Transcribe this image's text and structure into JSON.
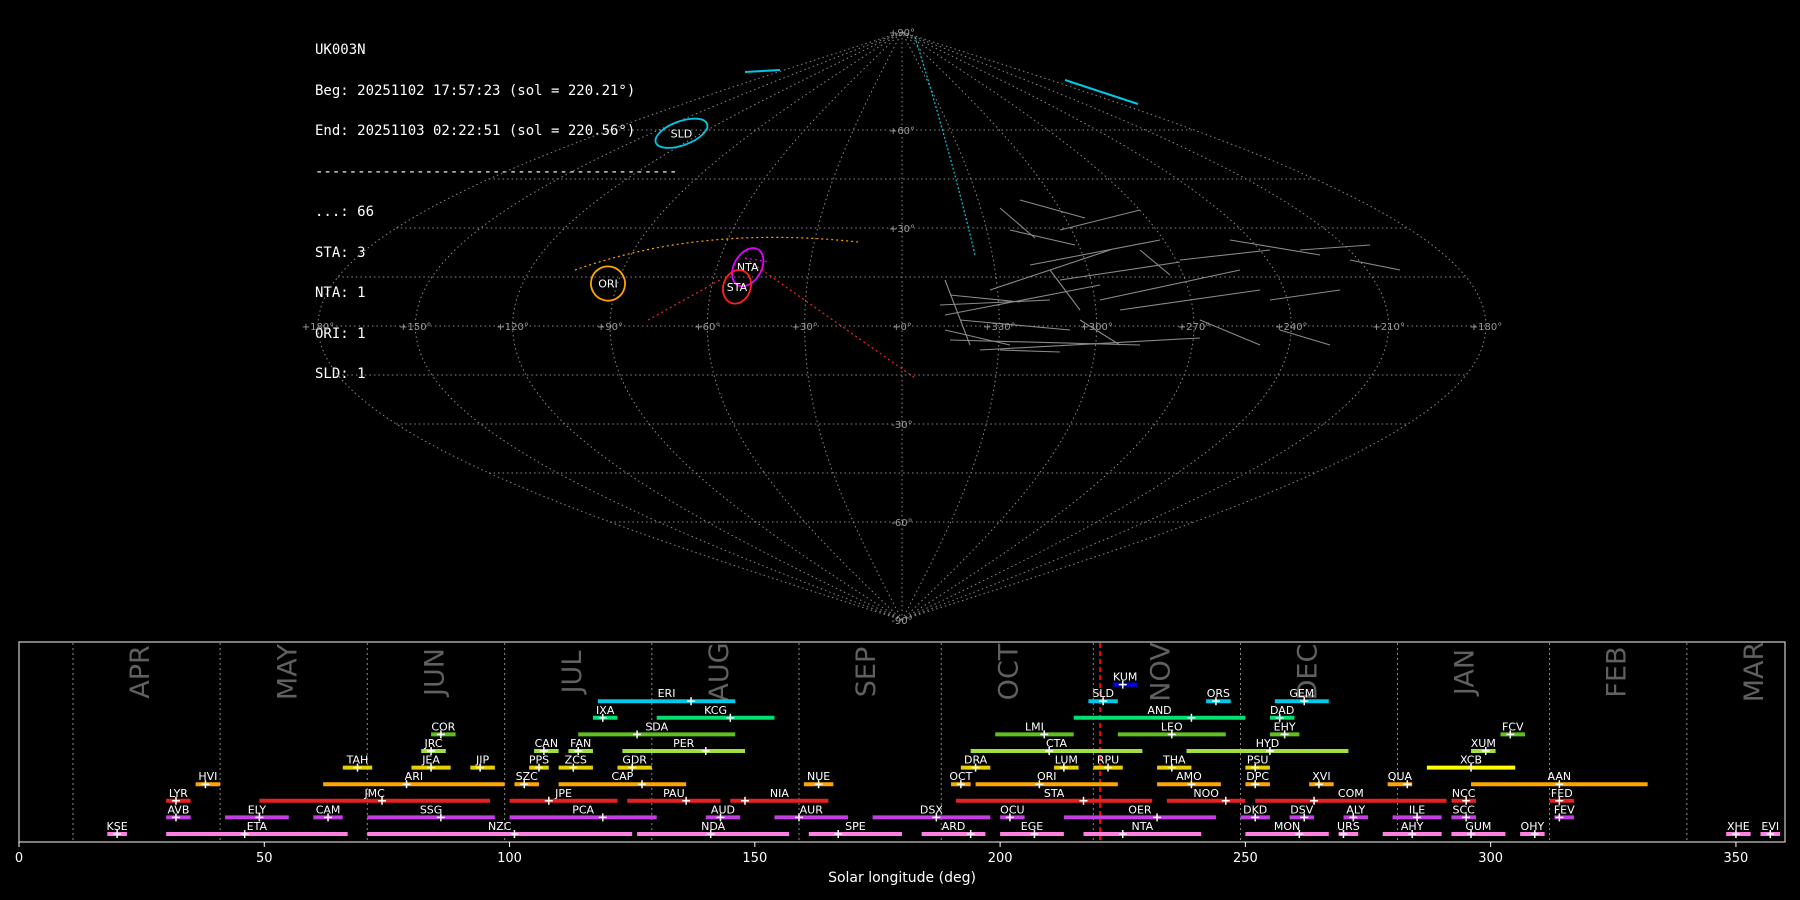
{
  "info": {
    "station": "UK003N",
    "begin": "Beg: 20251102 17:57:23 (sol = 220.21°)",
    "end": "End: 20251103 02:22:51 (sol = 220.56°)",
    "separator": "-------------------------------------------",
    "counts": [
      "...: 66",
      "STA: 3",
      "NTA: 1",
      "ORI: 1",
      "SLD: 1"
    ]
  },
  "sky_map": {
    "lon_labels": [
      "+180°",
      "+150°",
      "+120°",
      "+90°",
      "+60°",
      "+30°",
      "+0°",
      "+330°",
      "+300°",
      "+270°",
      "+240°",
      "+210°",
      "+180°"
    ],
    "lat_labels": [
      "+90°",
      "+60°",
      "+30°",
      "-30°",
      "-60°",
      "-90°"
    ],
    "radiants": [
      {
        "code": "SLD",
        "color": "#00c8e6",
        "lon": 132,
        "lat": 59,
        "rx": 8,
        "ry": 3.5,
        "rot": -20
      },
      {
        "code": "ORI",
        "color": "#ffa500",
        "lon": 93,
        "lat": 13,
        "rx": 5,
        "ry": 5,
        "rot": -30
      },
      {
        "code": "NTA",
        "color": "#e000ff",
        "lon": 50,
        "lat": 18,
        "rx": 4,
        "ry": 6,
        "rot": 30
      },
      {
        "code": "STA",
        "color": "#ff2020",
        "lon": 52,
        "lat": 12,
        "rx": 4,
        "ry": 5,
        "rot": 20
      }
    ]
  },
  "chart_data": {
    "type": "timeline",
    "xlabel": "Solar longitude (deg)",
    "xlim": [
      0,
      360
    ],
    "xticks": [
      0,
      50,
      100,
      150,
      200,
      250,
      300,
      350
    ],
    "current_sol": 220.4,
    "months": [
      {
        "name": "APR",
        "start": 11
      },
      {
        "name": "MAY",
        "start": 41
      },
      {
        "name": "JUN",
        "start": 71
      },
      {
        "name": "JUL",
        "start": 99
      },
      {
        "name": "AUG",
        "start": 129
      },
      {
        "name": "SEP",
        "start": 159
      },
      {
        "name": "OCT",
        "start": 188
      },
      {
        "name": "NOV",
        "start": 219
      },
      {
        "name": "DEC",
        "start": 249
      },
      {
        "name": "JAN",
        "start": 281
      },
      {
        "name": "FEB",
        "start": 312
      },
      {
        "name": "MAR",
        "start": 340
      }
    ],
    "showers": [
      {
        "code": "KUM",
        "row": 9,
        "start": 223,
        "end": 228,
        "peak": 225,
        "color": "#0000ff"
      },
      {
        "code": "ERI",
        "row": 8,
        "start": 118,
        "end": 146,
        "peak": 137,
        "color": "#00c8e6"
      },
      {
        "code": "SLD",
        "row": 8,
        "start": 218,
        "end": 224,
        "peak": 221,
        "color": "#00c8e6"
      },
      {
        "code": "ORS",
        "row": 8,
        "start": 242,
        "end": 247,
        "peak": 244,
        "color": "#00c8e6"
      },
      {
        "code": "GEM",
        "row": 8,
        "start": 256,
        "end": 267,
        "peak": 262,
        "color": "#00c8e6"
      },
      {
        "code": "IXA",
        "row": 7,
        "start": 117,
        "end": 122,
        "peak": 119,
        "color": "#00e070"
      },
      {
        "code": "KCG",
        "row": 7,
        "start": 130,
        "end": 154,
        "peak": 145,
        "color": "#00e070"
      },
      {
        "code": "AND",
        "row": 7,
        "start": 215,
        "end": 250,
        "peak": 239,
        "color": "#00e070"
      },
      {
        "code": "DAD",
        "row": 7,
        "start": 255,
        "end": 260,
        "peak": 257,
        "color": "#00e070"
      },
      {
        "code": "COR",
        "row": 6,
        "start": 84,
        "end": 89,
        "peak": 86,
        "color": "#60c020"
      },
      {
        "code": "SDA",
        "row": 6,
        "start": 114,
        "end": 146,
        "peak": 126,
        "color": "#60c020"
      },
      {
        "code": "LMI",
        "row": 6,
        "start": 199,
        "end": 215,
        "peak": 209,
        "color": "#60c020"
      },
      {
        "code": "LEO",
        "row": 6,
        "start": 224,
        "end": 246,
        "peak": 235,
        "color": "#60c020"
      },
      {
        "code": "EHY",
        "row": 6,
        "start": 255,
        "end": 261,
        "peak": 258,
        "color": "#60c020"
      },
      {
        "code": "FCV",
        "row": 6,
        "start": 302,
        "end": 307,
        "peak": 304,
        "color": "#60c020"
      },
      {
        "code": "JRC",
        "row": 5,
        "start": 82,
        "end": 87,
        "peak": 84,
        "color": "#a0e040"
      },
      {
        "code": "CAN",
        "row": 5,
        "start": 105,
        "end": 110,
        "peak": 107,
        "color": "#a0e040"
      },
      {
        "code": "FAN",
        "row": 5,
        "start": 112,
        "end": 117,
        "peak": 114,
        "color": "#a0e040"
      },
      {
        "code": "PER",
        "row": 5,
        "start": 123,
        "end": 148,
        "peak": 140,
        "color": "#a0e040"
      },
      {
        "code": "CTA",
        "row": 5,
        "start": 194,
        "end": 229,
        "peak": 210,
        "color": "#a0e040"
      },
      {
        "code": "HYD",
        "row": 5,
        "start": 238,
        "end": 271,
        "peak": 255,
        "color": "#a0e040"
      },
      {
        "code": "XUM",
        "row": 5,
        "start": 296,
        "end": 301,
        "peak": 299,
        "color": "#a0e040"
      },
      {
        "code": "TAH",
        "row": 4,
        "start": 66,
        "end": 72,
        "peak": 69,
        "color": "#e8d000"
      },
      {
        "code": "JEA",
        "row": 4,
        "start": 80,
        "end": 88,
        "peak": 84,
        "color": "#e8d000"
      },
      {
        "code": "JIP",
        "row": 4,
        "start": 92,
        "end": 97,
        "peak": 94,
        "color": "#e8d000"
      },
      {
        "code": "PPS",
        "row": 4,
        "start": 104,
        "end": 108,
        "peak": 106,
        "color": "#e8d000"
      },
      {
        "code": "ZCS",
        "row": 4,
        "start": 110,
        "end": 117,
        "peak": 113,
        "color": "#e8d000"
      },
      {
        "code": "GDR",
        "row": 4,
        "start": 122,
        "end": 129,
        "peak": 125,
        "color": "#e8d000"
      },
      {
        "code": "DRA",
        "row": 4,
        "start": 192,
        "end": 198,
        "peak": 195,
        "color": "#e8d000"
      },
      {
        "code": "LUM",
        "row": 4,
        "start": 211,
        "end": 216,
        "peak": 213,
        "color": "#e8d000"
      },
      {
        "code": "RPU",
        "row": 4,
        "start": 219,
        "end": 225,
        "peak": 222,
        "color": "#e8d000"
      },
      {
        "code": "THA",
        "row": 4,
        "start": 232,
        "end": 239,
        "peak": 235,
        "color": "#e8d000"
      },
      {
        "code": "PSU",
        "row": 4,
        "start": 250,
        "end": 255,
        "peak": 252,
        "color": "#e8d000"
      },
      {
        "code": "XCB",
        "row": 4,
        "start": 287,
        "end": 305,
        "peak": 296,
        "color": "#ffff00"
      },
      {
        "code": "HVI",
        "row": 3,
        "start": 36,
        "end": 41,
        "peak": 38,
        "color": "#ffa500"
      },
      {
        "code": "ARI",
        "row": 3,
        "start": 62,
        "end": 99,
        "peak": 79,
        "color": "#ffa500"
      },
      {
        "code": "SZC",
        "row": 3,
        "start": 101,
        "end": 106,
        "peak": 103,
        "color": "#ffa500"
      },
      {
        "code": "CAP",
        "row": 3,
        "start": 110,
        "end": 136,
        "peak": 127,
        "color": "#ffa500"
      },
      {
        "code": "NUE",
        "row": 3,
        "start": 160,
        "end": 166,
        "peak": 163,
        "color": "#ffa500"
      },
      {
        "code": "OCT",
        "row": 3,
        "start": 190,
        "end": 194,
        "peak": 192,
        "color": "#ffa500"
      },
      {
        "code": "ORI",
        "row": 3,
        "start": 195,
        "end": 224,
        "peak": 208,
        "color": "#ffa500"
      },
      {
        "code": "AMO",
        "row": 3,
        "start": 232,
        "end": 245,
        "peak": 239,
        "color": "#ffa500"
      },
      {
        "code": "DPC",
        "row": 3,
        "start": 250,
        "end": 255,
        "peak": 252,
        "color": "#ffa500"
      },
      {
        "code": "XVI",
        "row": 3,
        "start": 263,
        "end": 268,
        "peak": 265,
        "color": "#ffa500"
      },
      {
        "code": "QUA",
        "row": 3,
        "start": 279,
        "end": 284,
        "peak": 283,
        "color": "#ffa500"
      },
      {
        "code": "AAN",
        "row": 3,
        "start": 296,
        "end": 332,
        "peak": 314,
        "color": "#ffa500"
      },
      {
        "code": "LYR",
        "row": 2,
        "start": 30,
        "end": 35,
        "peak": 32,
        "color": "#e82020"
      },
      {
        "code": "JMC",
        "row": 2,
        "start": 49,
        "end": 96,
        "peak": 74,
        "color": "#e82020"
      },
      {
        "code": "JPE",
        "row": 2,
        "start": 100,
        "end": 122,
        "peak": 108,
        "color": "#e82020"
      },
      {
        "code": "PAU",
        "row": 2,
        "start": 124,
        "end": 143,
        "peak": 136,
        "color": "#e82020"
      },
      {
        "code": "NIA",
        "row": 2,
        "start": 145,
        "end": 165,
        "peak": 148,
        "color": "#e82020"
      },
      {
        "code": "STA",
        "row": 2,
        "start": 191,
        "end": 231,
        "peak": 217,
        "color": "#e82020"
      },
      {
        "code": "NOO",
        "row": 2,
        "start": 234,
        "end": 250,
        "peak": 246,
        "color": "#e82020"
      },
      {
        "code": "COM",
        "row": 2,
        "start": 252,
        "end": 291,
        "peak": 264,
        "color": "#e82020"
      },
      {
        "code": "NCC",
        "row": 2,
        "start": 292,
        "end": 297,
        "peak": 295,
        "color": "#e82020"
      },
      {
        "code": "FED",
        "row": 2,
        "start": 312,
        "end": 317,
        "peak": 314,
        "color": "#e82020"
      },
      {
        "code": "AVB",
        "row": 1,
        "start": 30,
        "end": 35,
        "peak": 32,
        "color": "#c040e0"
      },
      {
        "code": "ELY",
        "row": 1,
        "start": 42,
        "end": 55,
        "peak": 49,
        "color": "#c040e0"
      },
      {
        "code": "CAM",
        "row": 1,
        "start": 60,
        "end": 66,
        "peak": 63,
        "color": "#c040e0"
      },
      {
        "code": "SSG",
        "row": 1,
        "start": 71,
        "end": 97,
        "peak": 86,
        "color": "#c040e0"
      },
      {
        "code": "PCA",
        "row": 1,
        "start": 100,
        "end": 130,
        "peak": 119,
        "color": "#c040e0"
      },
      {
        "code": "AUD",
        "row": 1,
        "start": 140,
        "end": 147,
        "peak": 143,
        "color": "#c040e0"
      },
      {
        "code": "AUR",
        "row": 1,
        "start": 154,
        "end": 169,
        "peak": 159,
        "color": "#c040e0"
      },
      {
        "code": "DSX",
        "row": 1,
        "start": 174,
        "end": 198,
        "peak": 187,
        "color": "#c040e0"
      },
      {
        "code": "OCU",
        "row": 1,
        "start": 200,
        "end": 205,
        "peak": 202,
        "color": "#c040e0"
      },
      {
        "code": "OER",
        "row": 1,
        "start": 213,
        "end": 244,
        "peak": 232,
        "color": "#c040e0"
      },
      {
        "code": "DKD",
        "row": 1,
        "start": 249,
        "end": 255,
        "peak": 252,
        "color": "#c040e0"
      },
      {
        "code": "DSV",
        "row": 1,
        "start": 259,
        "end": 264,
        "peak": 262,
        "color": "#c040e0"
      },
      {
        "code": "ALY",
        "row": 1,
        "start": 270,
        "end": 275,
        "peak": 272,
        "color": "#c040e0"
      },
      {
        "code": "ILE",
        "row": 1,
        "start": 280,
        "end": 290,
        "peak": 285,
        "color": "#c040e0"
      },
      {
        "code": "SCC",
        "row": 1,
        "start": 292,
        "end": 297,
        "peak": 295,
        "color": "#c040e0"
      },
      {
        "code": "FEV",
        "row": 1,
        "start": 313,
        "end": 317,
        "peak": 314,
        "color": "#c040e0"
      },
      {
        "code": "KSE",
        "row": 0,
        "start": 18,
        "end": 22,
        "peak": 20,
        "color": "#ff80e0"
      },
      {
        "code": "ETA",
        "row": 0,
        "start": 30,
        "end": 67,
        "peak": 46,
        "color": "#ff80e0"
      },
      {
        "code": "NZC",
        "row": 0,
        "start": 71,
        "end": 125,
        "peak": 101,
        "color": "#ff80e0"
      },
      {
        "code": "NDA",
        "row": 0,
        "start": 126,
        "end": 157,
        "peak": 141,
        "color": "#ff80e0"
      },
      {
        "code": "SPE",
        "row": 0,
        "start": 161,
        "end": 180,
        "peak": 167,
        "color": "#ff80e0"
      },
      {
        "code": "ARD",
        "row": 0,
        "start": 184,
        "end": 197,
        "peak": 194,
        "color": "#ff80e0"
      },
      {
        "code": "EGE",
        "row": 0,
        "start": 200,
        "end": 213,
        "peak": 207,
        "color": "#ff80e0"
      },
      {
        "code": "NTA",
        "row": 0,
        "start": 217,
        "end": 241,
        "peak": 225,
        "color": "#ff80e0"
      },
      {
        "code": "MON",
        "row": 0,
        "start": 250,
        "end": 267,
        "peak": 261,
        "color": "#ff80e0"
      },
      {
        "code": "URS",
        "row": 0,
        "start": 269,
        "end": 273,
        "peak": 270,
        "color": "#ff80e0"
      },
      {
        "code": "AHY",
        "row": 0,
        "start": 278,
        "end": 290,
        "peak": 284,
        "color": "#ff80e0"
      },
      {
        "code": "GUM",
        "row": 0,
        "start": 292,
        "end": 303,
        "peak": 296,
        "color": "#ff80e0"
      },
      {
        "code": "OHY",
        "row": 0,
        "start": 306,
        "end": 311,
        "peak": 309,
        "color": "#ff80e0"
      },
      {
        "code": "XHE",
        "row": 0,
        "start": 348,
        "end": 353,
        "peak": 350,
        "color": "#ff80e0"
      },
      {
        "code": "EVI",
        "row": 0,
        "start": 355,
        "end": 359,
        "peak": 357,
        "color": "#ff80e0"
      }
    ]
  }
}
